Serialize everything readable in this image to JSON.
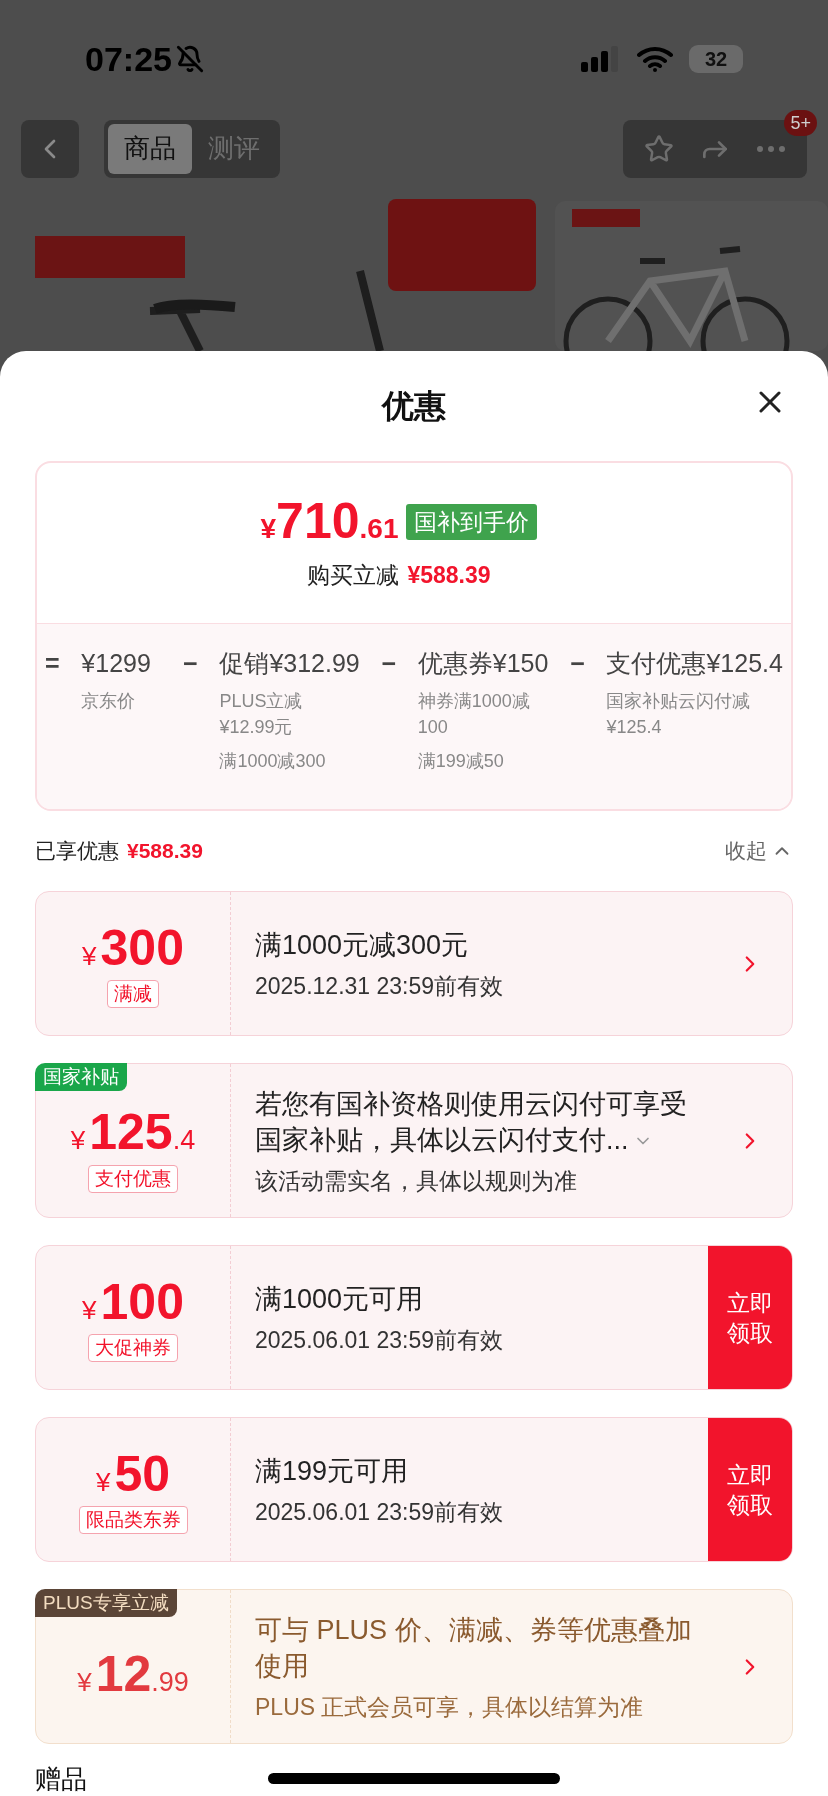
{
  "status_bar": {
    "time": "07:25",
    "battery": "32"
  },
  "nav": {
    "tabs": [
      {
        "label": "商品",
        "selected": true
      },
      {
        "label": "测评",
        "selected": false
      }
    ],
    "badge": "5+"
  },
  "sheet": {
    "title": "优惠",
    "summary": {
      "currency": "¥",
      "price_int": "710",
      "price_dec": ".61",
      "price_tag": "国补到手价",
      "saving_label": "购买立减",
      "saving": "¥588.39",
      "breakdown": [
        {
          "op": "=",
          "amount": "¥1299",
          "notes": [
            "京东价"
          ]
        },
        {
          "op": "−",
          "label": "促销",
          "amount": "¥312.99",
          "notes": [
            "PLUS立减¥12.99元",
            "满1000减300"
          ]
        },
        {
          "op": "−",
          "label": "优惠券",
          "amount": "¥150",
          "notes": [
            "神券满1000减100",
            "满199减50"
          ]
        },
        {
          "op": "−",
          "label": "支付优惠",
          "amount": "¥125.4",
          "notes": [
            "国家补贴云闪付减¥125.4"
          ]
        }
      ]
    },
    "enjoyed": {
      "label": "已享优惠",
      "amount": "¥588.39",
      "collapse": "收起"
    },
    "offers": [
      {
        "kind": "discount",
        "currency": "¥",
        "amount": "300",
        "tag": "满减",
        "title": "满1000元减300元",
        "subtitle": "2025.12.31 23:59前有效"
      },
      {
        "kind": "subsidy",
        "corner_tag": "国家补贴",
        "currency": "¥",
        "amount": "125",
        "decimal": ".4",
        "tag": "支付优惠",
        "title": "若您有国补资格则使用云闪付可享受国家补贴，具体以云闪付支付...",
        "subtitle": "该活动需实名，具体以规则为准"
      },
      {
        "kind": "coupon",
        "currency": "¥",
        "amount": "100",
        "tag": "大促神券",
        "title": "满1000元可用",
        "subtitle": "2025.06.01 23:59前有效",
        "action": "立即领取"
      },
      {
        "kind": "coupon",
        "currency": "¥",
        "amount": "50",
        "tag": "限品类东券",
        "title": "满199元可用",
        "subtitle": "2025.06.01 23:59前有效",
        "action": "立即领取"
      },
      {
        "kind": "plus",
        "corner_tag": "PLUS专享立减",
        "currency": "¥",
        "amount": "12",
        "decimal": ".99",
        "title": "可与 PLUS 价、满减、券等优惠叠加使用",
        "subtitle": "PLUS 正式会员可享，具体以结算为准"
      }
    ],
    "next_section": "赠品"
  }
}
